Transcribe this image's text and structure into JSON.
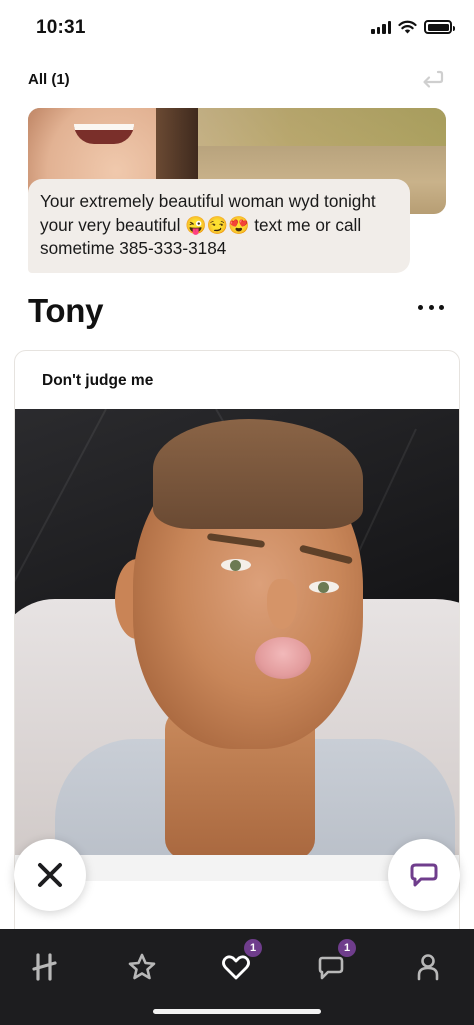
{
  "status_bar": {
    "time": "10:31"
  },
  "header": {
    "filter_label": "All (1)",
    "undo_icon": "undo-arrow-icon"
  },
  "like": {
    "message": "Your extremely beautiful woman wyd tonight your very beautiful 😜😏😍 text me or call sometime 385-333-3184"
  },
  "profile": {
    "name": "Tony",
    "more_icon": "more-dots-icon"
  },
  "card": {
    "prompt": "Don't judge me"
  },
  "actions": {
    "skip_icon": "close-icon",
    "chat_icon": "chat-bubble-icon"
  },
  "tabbar": {
    "items": [
      {
        "icon": "hinge-logo-icon",
        "badge": ""
      },
      {
        "icon": "star-icon",
        "badge": ""
      },
      {
        "icon": "heart-icon",
        "badge": "1"
      },
      {
        "icon": "messages-icon",
        "badge": "1"
      },
      {
        "icon": "profile-icon",
        "badge": ""
      }
    ]
  },
  "colors": {
    "tabbar_bg": "#1d1d1f",
    "badge": "#6f3d8c",
    "bubble_bg": "#f1ede9",
    "chat_icon": "#6f3d8c"
  }
}
